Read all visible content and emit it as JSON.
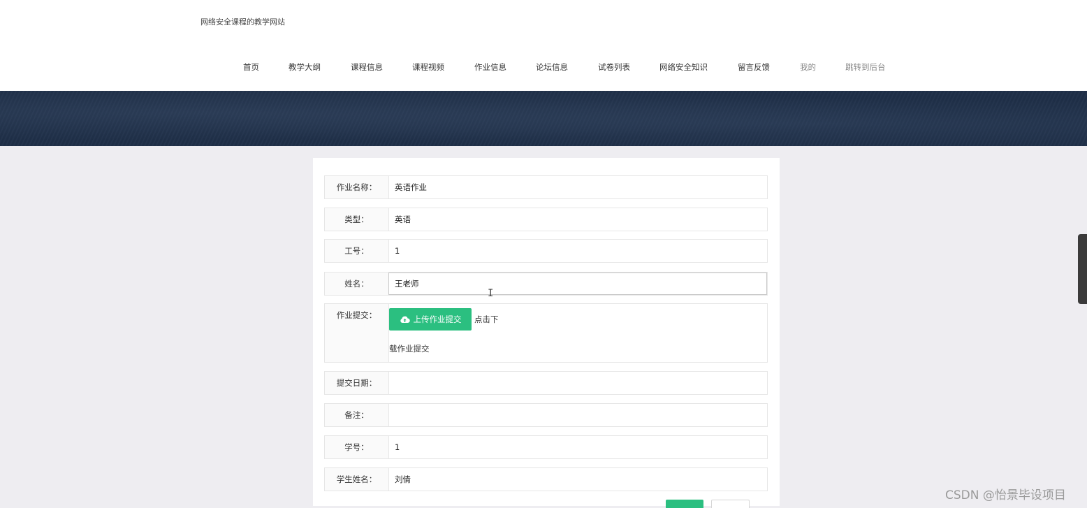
{
  "site": {
    "title": "网络安全课程的教学网站"
  },
  "nav": {
    "items": [
      {
        "label": "首页"
      },
      {
        "label": "教学大纲"
      },
      {
        "label": "课程信息"
      },
      {
        "label": "课程视频"
      },
      {
        "label": "作业信息"
      },
      {
        "label": "论坛信息"
      },
      {
        "label": "试卷列表"
      },
      {
        "label": "网络安全知识"
      },
      {
        "label": "留言反馈"
      },
      {
        "label": "我的"
      },
      {
        "label": "跳转到后台"
      }
    ]
  },
  "form": {
    "assignment_name": {
      "label": "作业名称：",
      "value": "英语作业"
    },
    "type": {
      "label": "类型：",
      "value": "英语"
    },
    "staff_id": {
      "label": "工号：",
      "value": "1"
    },
    "name": {
      "label": "姓名：",
      "value": "王老师"
    },
    "submission": {
      "label": "作业提交：",
      "upload_button": "上传作业提交",
      "hint_line1": "点击下",
      "hint_line2": "载作业提交"
    },
    "submit_date": {
      "label": "提交日期：",
      "value": ""
    },
    "remarks": {
      "label": "备注：",
      "value": ""
    },
    "student_id": {
      "label": "学号：",
      "value": "1"
    },
    "student_name": {
      "label": "学生姓名：",
      "value": "刘倩"
    }
  },
  "watermark": "CSDN @怡景毕设项目",
  "colors": {
    "accent": "#2bbf80",
    "banner": "#1f2f48"
  },
  "icons": {
    "upload": "cloud-upload-icon"
  }
}
